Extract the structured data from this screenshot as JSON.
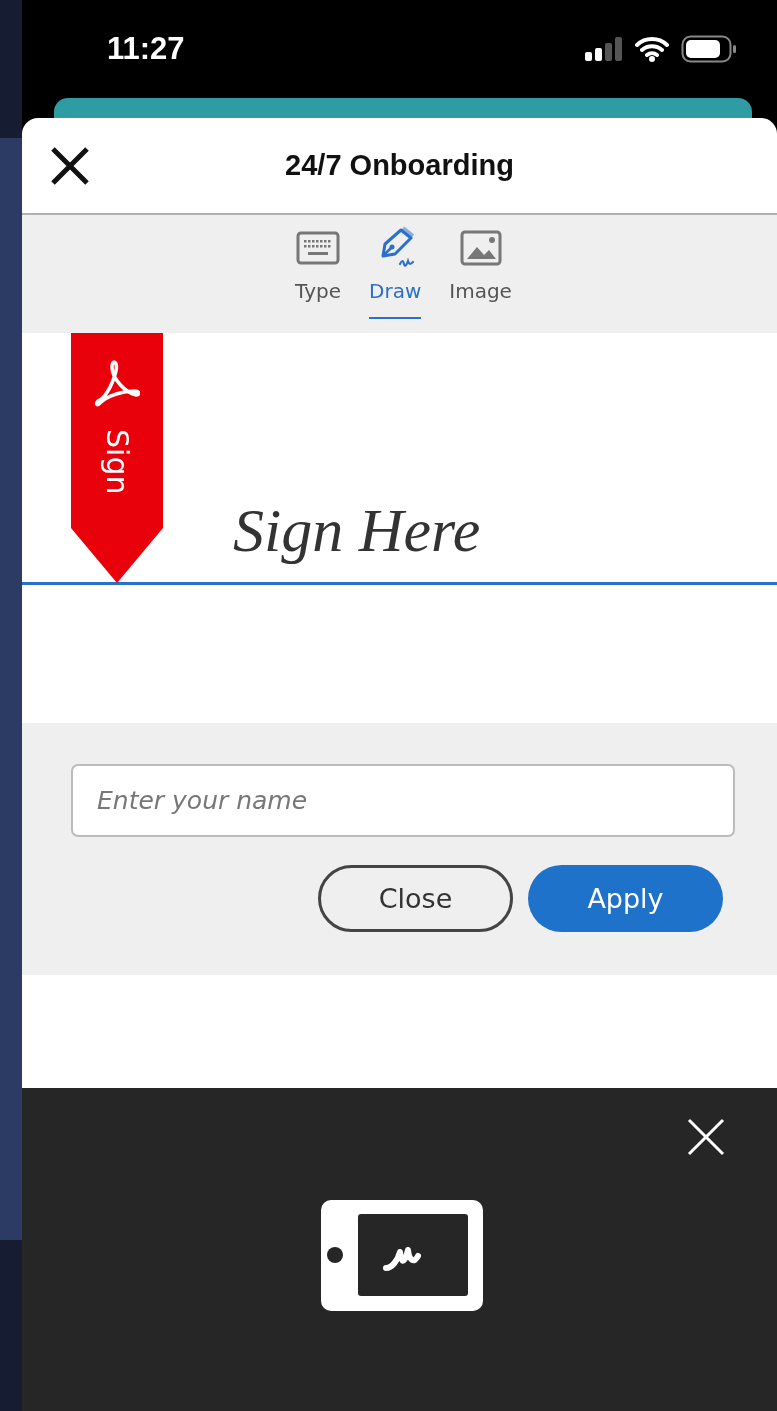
{
  "status_bar": {
    "time": "11:27"
  },
  "dialog": {
    "title": "24/7 Onboarding"
  },
  "tabs": [
    {
      "label": "Type",
      "kind": "keyboard",
      "selected": false
    },
    {
      "label": "Draw",
      "kind": "pen",
      "selected": true
    },
    {
      "label": "Image",
      "kind": "image",
      "selected": false
    }
  ],
  "signature_pad": {
    "flag_label": "Sign",
    "hint": "Sign Here"
  },
  "name_field": {
    "placeholder": "Enter your name"
  },
  "buttons": [
    {
      "label": "Close",
      "kind": "secondary"
    },
    {
      "label": "Apply",
      "kind": "primary"
    }
  ]
}
